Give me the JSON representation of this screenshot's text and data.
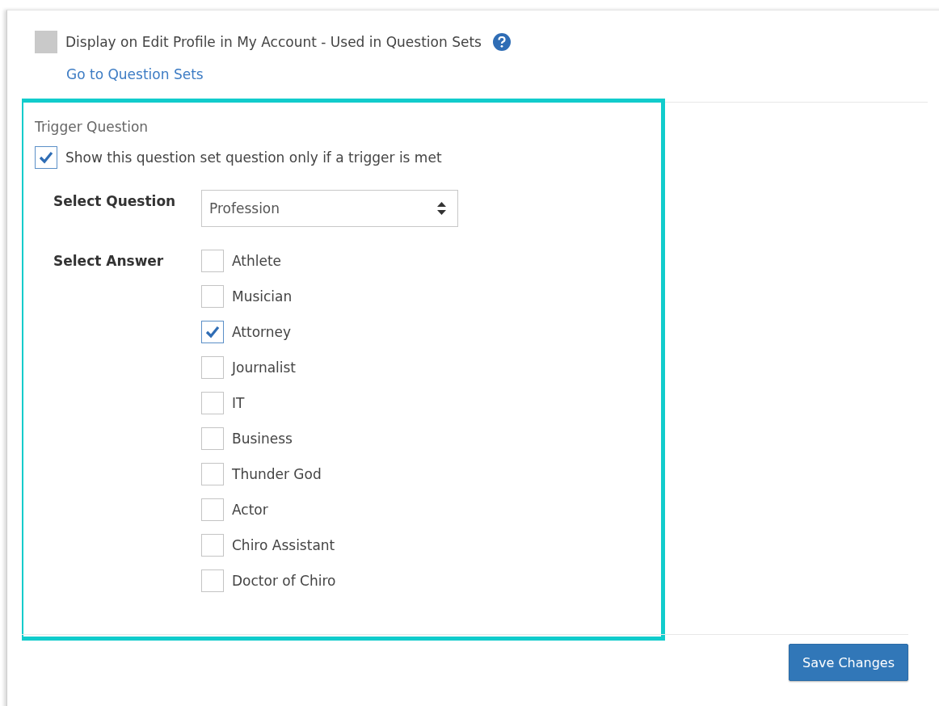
{
  "profile_option": {
    "label": "Display on Edit Profile in My Account - Used in Question Sets",
    "checked": false,
    "disabled": true,
    "link": "Go to Question Sets"
  },
  "trigger": {
    "heading": "Trigger Question",
    "checkbox": {
      "label": "Show this question set question only if a trigger is met",
      "checked": true
    },
    "question": {
      "label": "Select Question",
      "value": "Profession"
    },
    "answer_label": "Select Answer",
    "answers": [
      {
        "label": "Athlete",
        "checked": false
      },
      {
        "label": "Musician",
        "checked": false
      },
      {
        "label": "Attorney",
        "checked": true
      },
      {
        "label": "Journalist",
        "checked": false
      },
      {
        "label": "IT",
        "checked": false
      },
      {
        "label": "Business",
        "checked": false
      },
      {
        "label": "Thunder God",
        "checked": false
      },
      {
        "label": "Actor",
        "checked": false
      },
      {
        "label": "Chiro Assistant",
        "checked": false
      },
      {
        "label": "Doctor of Chiro",
        "checked": false
      }
    ]
  },
  "save_button": "Save Changes"
}
